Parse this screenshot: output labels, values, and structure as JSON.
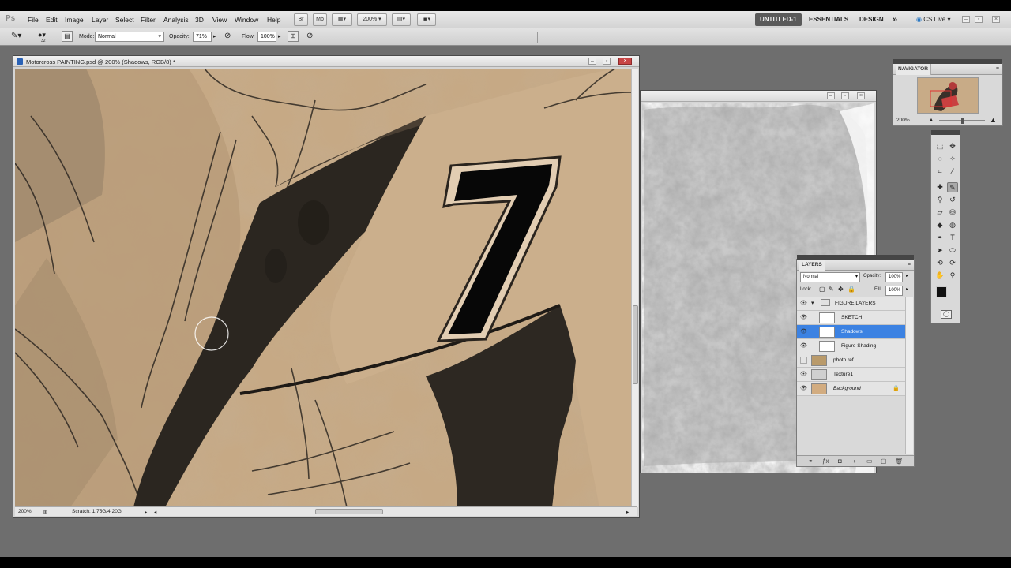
{
  "app": {
    "logo": "Ps"
  },
  "menu": [
    "File",
    "Edit",
    "Image",
    "Layer",
    "Select",
    "Filter",
    "Analysis",
    "3D",
    "View",
    "Window",
    "Help"
  ],
  "appbar": {
    "zoom": "200%"
  },
  "workspaces": {
    "active": "UNTITLED-1",
    "essentials": "ESSENTIALS",
    "design": "DESIGN",
    "more": "»",
    "cslive": "CS Live"
  },
  "options": {
    "brush_size": "32",
    "mode_label": "Mode:",
    "mode_value": "Normal",
    "opacity_label": "Opacity:",
    "opacity_value": "71%",
    "flow_label": "Flow:",
    "flow_value": "100%"
  },
  "main_doc": {
    "title": "Motorcross PAINTING.psd @ 200% (Shadows, RGB/8) *",
    "zoom": "200%",
    "scratch": "Scratch: 1.75G/4.20G",
    "number": "7"
  },
  "navigator": {
    "title": "NAVIGATOR",
    "zoom": "200%"
  },
  "layers": {
    "title": "LAYERS",
    "blend_mode": "Normal",
    "opacity_label": "Opacity:",
    "opacity_value": "100%",
    "lock_label": "Lock:",
    "fill_label": "Fill:",
    "fill_value": "100%",
    "items": [
      {
        "name": "FIGURE LAYERS",
        "visible": true
      },
      {
        "name": "SKETCH",
        "visible": true
      },
      {
        "name": "Shadows",
        "visible": true
      },
      {
        "name": "Figure Shading",
        "visible": true
      },
      {
        "name": "photo ref",
        "visible": false
      },
      {
        "name": "Texture1",
        "visible": true
      },
      {
        "name": "Background",
        "visible": true
      }
    ]
  },
  "colors": {
    "canvas_tan": "#c6a985",
    "shadow": "#2b2620",
    "selection": "#3c82e2",
    "foreground": "#111111",
    "background": "#ffffff"
  }
}
